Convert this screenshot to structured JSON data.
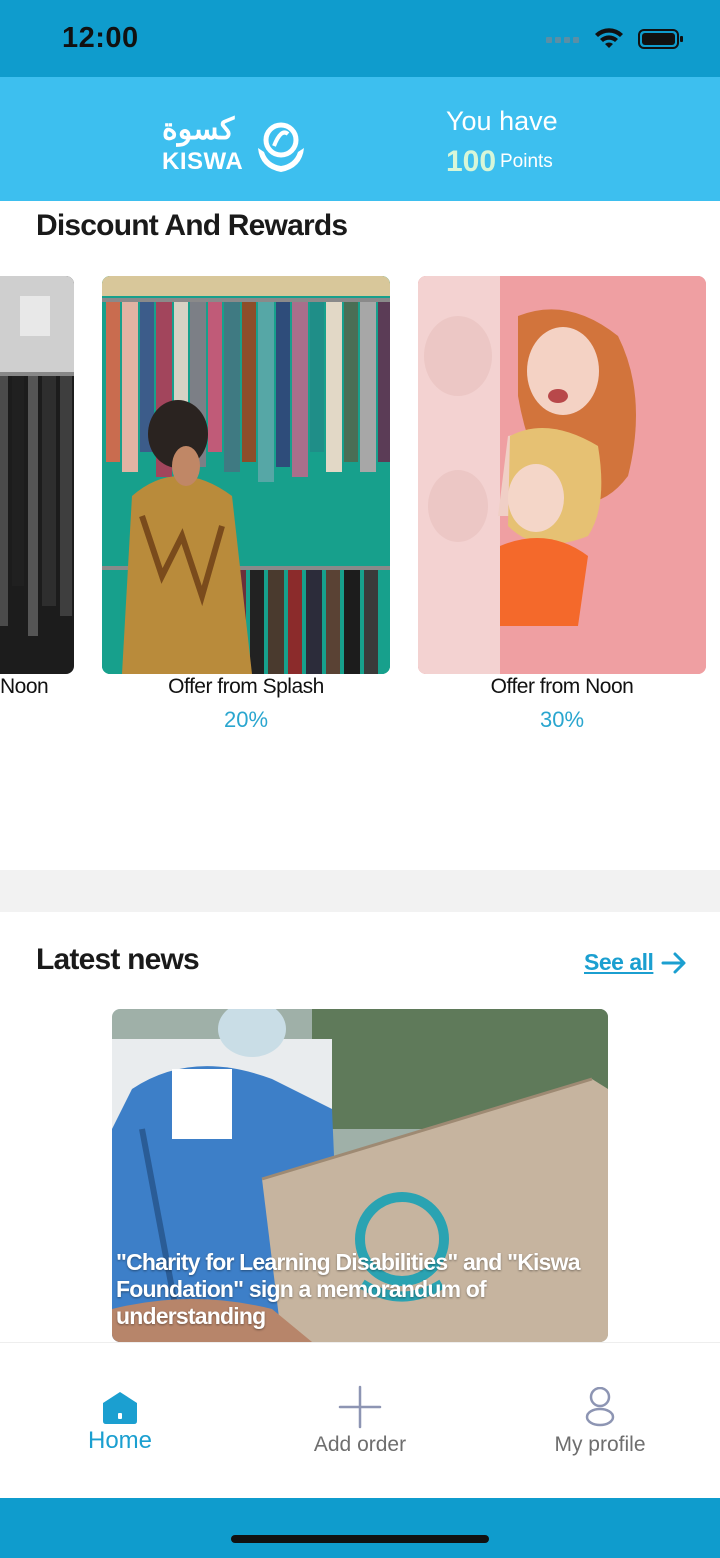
{
  "status": {
    "time": "12:00"
  },
  "header": {
    "logo_arabic": "كسوة",
    "logo_english": "KISWA",
    "points_label": "You have",
    "points_value": "100",
    "points_unit": "Points"
  },
  "rewards": {
    "title": "Discount And Rewards",
    "items": [
      {
        "title": "Noon",
        "percent": ""
      },
      {
        "title": "Offer from Splash",
        "percent": "20%"
      },
      {
        "title": "Offer from Noon",
        "percent": "30%"
      }
    ]
  },
  "news": {
    "title": "Latest news",
    "see_all": "See all",
    "items": [
      {
        "caption": "\"Charity for Learning Disabilities\" and \"Kiswa Foundation\" sign a memorandum of understanding"
      }
    ]
  },
  "tabs": [
    {
      "label": "Home",
      "icon": "home-icon",
      "active": true
    },
    {
      "label": "Add order",
      "icon": "plus-icon",
      "active": false
    },
    {
      "label": "My profile",
      "icon": "person-icon",
      "active": false
    }
  ],
  "colors": {
    "brand": "#3dbfef",
    "status": "#0f9ccd",
    "accent": "#1b9fd0"
  }
}
